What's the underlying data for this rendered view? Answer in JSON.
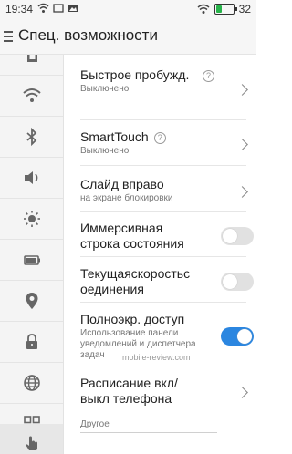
{
  "status_bar": {
    "time": "19:34",
    "battery_level": "32",
    "battery_fraction": 0.32,
    "icons": [
      "wifi-icon",
      "screen-icon",
      "image-icon",
      "wifi-icon",
      "battery-icon"
    ]
  },
  "app_bar": {
    "title": "Спец. возможности"
  },
  "rail": {
    "items": [
      "sim-icon",
      "wifi-icon",
      "bluetooth-icon",
      "sound-icon",
      "brightness-icon",
      "battery-icon",
      "location-icon",
      "lock-icon",
      "globe-icon",
      "apps-grid-icon",
      "gesture-hand-icon",
      "info-icon"
    ],
    "active": "gesture-hand-icon"
  },
  "settings": {
    "quick_wake": {
      "label": "Быстрое пробужд.",
      "sub": "Выключено"
    },
    "smarttouch": {
      "label": "SmartTouch",
      "sub": "Выключено"
    },
    "swipe_right": {
      "label": "Слайд вправо",
      "sub": "на экране блокировки"
    },
    "immersive": {
      "label": "Иммерсивная строка состояния",
      "enabled": false
    },
    "connection_speed": {
      "label": "Текущаяскоростьс оединения",
      "enabled": false
    },
    "fullscreen": {
      "label": "Полноэкр. доступ",
      "sub": "Использование панели уведомлений и диспетчера задач",
      "enabled": true
    },
    "schedule": {
      "label": "Расписание вкл/ выкл телефона"
    }
  },
  "section_other": "Другое",
  "watermark": "mobile-review.com"
}
